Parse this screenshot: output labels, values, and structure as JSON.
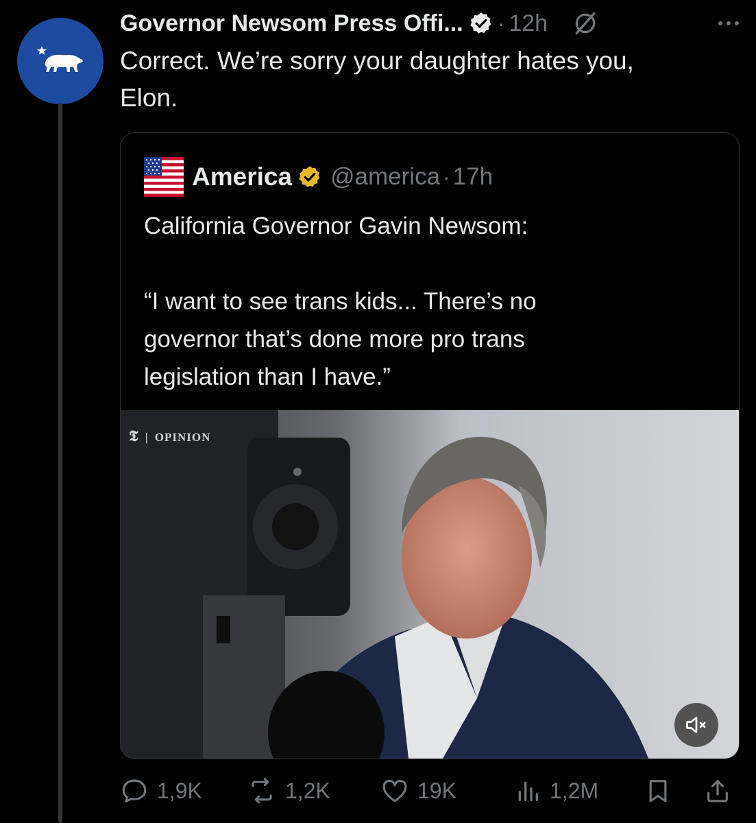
{
  "tweet": {
    "author_name": "Governor Newsom Press Offi...",
    "time": "12h",
    "text_line1": "Correct. We’re sorry your daughter hates you,",
    "text_line2": "Elon.",
    "avatar_icon": "california-bear-flag-icon",
    "avatar_color": "#1d4ba0"
  },
  "quote": {
    "author_name": "America",
    "handle": "@america",
    "time": "17h",
    "avatar_icon": "us-flag-icon",
    "verified_color": "#e8b829",
    "text_line1": "California Governor Gavin Newsom:",
    "text_line2": "“I want to see trans kids... There’s no",
    "text_line3": "governor that’s done more pro trans",
    "text_line4": "legislation than I have.”",
    "media": {
      "watermark": "OPINION",
      "mute_icon": "speaker-muted-icon"
    }
  },
  "actions": {
    "replies": "1,9K",
    "reposts": "1,2K",
    "likes": "19K",
    "views": "1,2M"
  },
  "colors": {
    "background": "#000000",
    "text": "#e7e9ea",
    "secondary": "#71767b",
    "border": "#2f3336",
    "verified_blue_owner": "#e7e9ea"
  }
}
